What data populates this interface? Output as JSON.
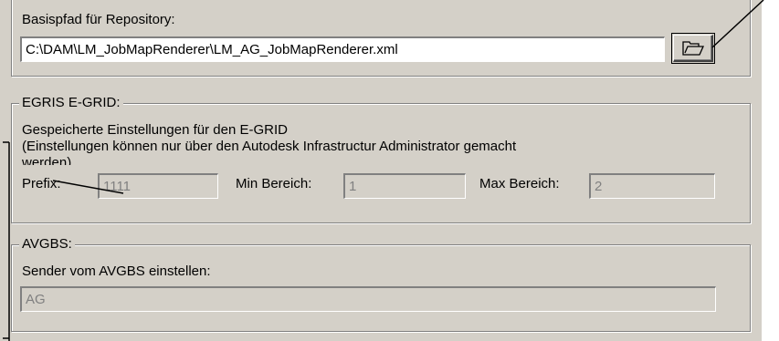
{
  "repository": {
    "label": "Basispfad für Repository:",
    "path_value": "C:\\DAM\\LM_JobMapRenderer\\LM_AG_JobMapRenderer.xml",
    "browse_icon": "folder-open-icon"
  },
  "egrid": {
    "group_title": "EGRIS E-GRID:",
    "description_line1": "Gespeicherte Einstellungen für den E-GRID",
    "description_line2": "(Einstellungen können nur über den Autodesk Infrastructur Administrator gemacht",
    "description_line3": "werden)",
    "prefix_label": "Prefix:",
    "prefix_value": "1111",
    "min_label": "Min Bereich:",
    "min_value": "1",
    "max_label": "Max Bereich:",
    "max_value": "2"
  },
  "avgbs": {
    "group_title": "AVGBS:",
    "sender_label": "Sender vom AVGBS einstellen:",
    "sender_value": "AG"
  },
  "colors": {
    "dialog_background": "#d4d0c8",
    "disabled_text": "#808080",
    "annotation_line": "#000000"
  }
}
